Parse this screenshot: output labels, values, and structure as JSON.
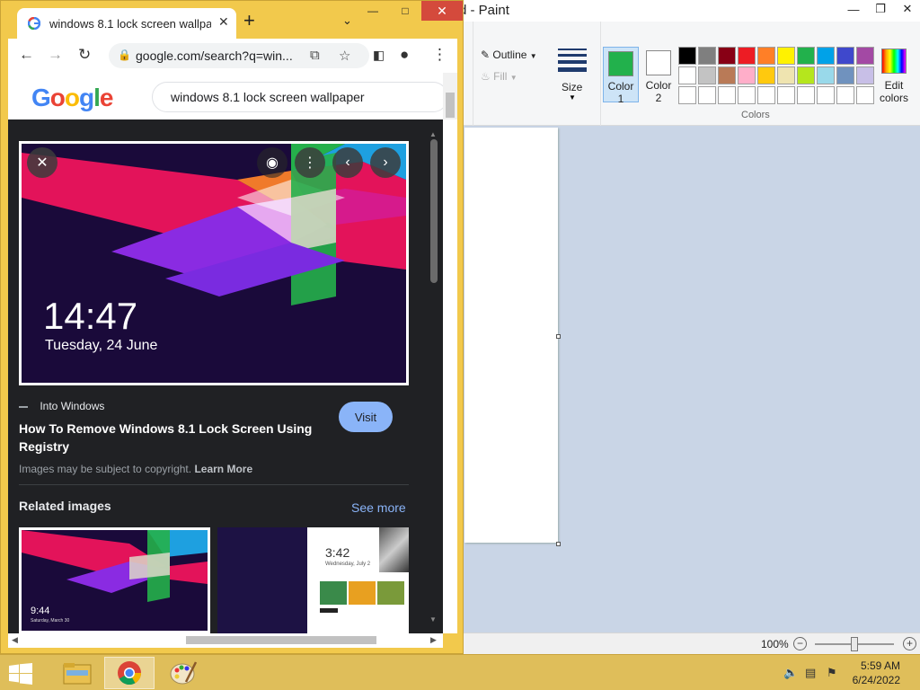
{
  "paint": {
    "title": "d - Paint",
    "outline_label": "Outline",
    "fill_label": "Fill",
    "size_label": "Size",
    "color1_label_line1": "Color",
    "color1_label_line2": "1",
    "color2_label_line1": "Color",
    "color2_label_line2": "2",
    "colors_group_label": "Colors",
    "edit_colors_line1": "Edit",
    "edit_colors_line2": "colors",
    "color1_value": "#22b14c",
    "color2_value": "#ffffff",
    "palette": [
      "#000000",
      "#7f7f7f",
      "#880015",
      "#ed1c24",
      "#ff7f27",
      "#fff200",
      "#22b14c",
      "#00a2e8",
      "#3f48cc",
      "#a349a4",
      "#ffffff",
      "#c3c3c3",
      "#b97a57",
      "#ffaec9",
      "#ffc90e",
      "#efe4b0",
      "#b5e61d",
      "#99d9ea",
      "#7092be",
      "#c8bfe7",
      "#ffffff",
      "#ffffff",
      "#ffffff",
      "#ffffff",
      "#ffffff",
      "#ffffff",
      "#ffffff",
      "#ffffff",
      "#ffffff",
      "#ffffff"
    ],
    "zoom": "100%"
  },
  "chrome": {
    "tab_title": "windows 8.1 lock screen wallpaper",
    "url": "google.com/search?q=win...",
    "search_query": "windows 8.1 lock screen wallpaper",
    "preview": {
      "time": "14:47",
      "date": "Tuesday, 24 June"
    },
    "source": "Into Windows",
    "result_title": "How To Remove Windows 8.1 Lock Screen Using Registry",
    "visit_label": "Visit",
    "copyright_text": "Images may be subject to copyright.",
    "learn_more": "Learn More",
    "related_heading": "Related images",
    "see_more": "See more",
    "thumb1_time": "9:44",
    "thumb1_date": "Saturday, March 30",
    "thumb2_time": "3:42",
    "thumb2_date": "Wednesday, July 2"
  },
  "taskbar": {
    "time": "5:59 AM",
    "date": "6/24/2022"
  }
}
